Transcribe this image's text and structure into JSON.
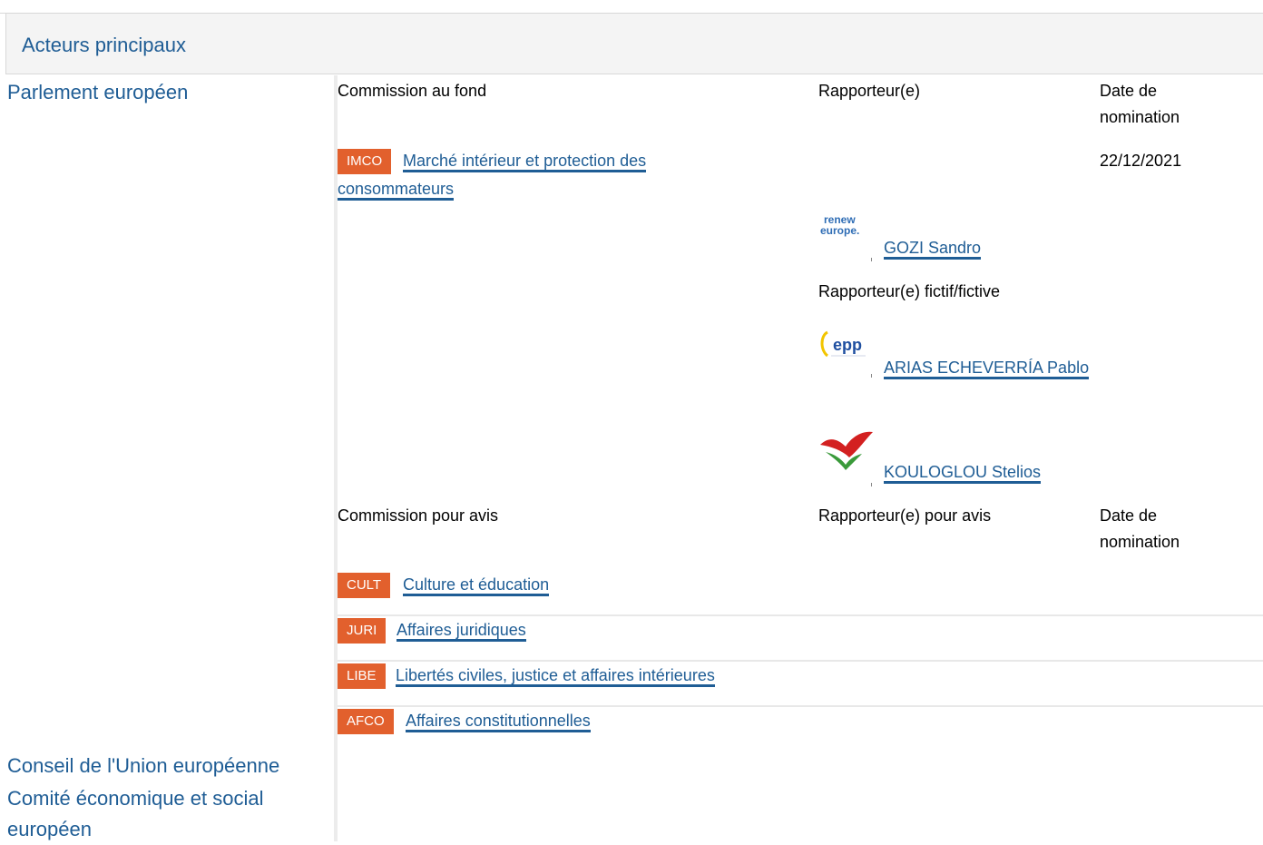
{
  "section_title": "Acteurs principaux",
  "actors": {
    "parliament": "Parlement européen",
    "council": "Conseil de l'Union européenne",
    "eesc": "Comité économique et social européen"
  },
  "responsible": {
    "committee_header": "Commission au fond",
    "rapporteur_header": "Rapporteur(e)",
    "date_header": "Date de nomination",
    "committee_code": "IMCO",
    "committee_name": "Marché intérieur et protection des consommateurs",
    "date": "22/12/2021",
    "rapporteur": {
      "name": "GOZI Sandro",
      "group_logo_text": "renew europe.",
      "group_logo_color": "#2f6db5"
    },
    "shadow_header": "Rapporteur(e) fictif/fictive",
    "shadows": [
      {
        "name": "ARIAS ECHEVERRÍA Pablo",
        "group_logo_text": "epp",
        "group_logo_color": "#1f4fa0"
      },
      {
        "name": "KOULOGLOU Stelios",
        "group_logo_text": "",
        "group_logo_color": "#d32020"
      }
    ]
  },
  "opinion": {
    "committee_header": "Commission pour avis",
    "rapporteur_header": "Rapporteur(e) pour avis",
    "date_header": "Date de nomination",
    "committees": [
      {
        "code": "CULT",
        "name": "Culture et éducation"
      },
      {
        "code": "JURI",
        "name": "Affaires juridiques"
      },
      {
        "code": "LIBE",
        "name": "Libertés civiles, justice et affaires intérieures"
      },
      {
        "code": "AFCO",
        "name": "Affaires constitutionnelles"
      }
    ]
  },
  "colors": {
    "link": "#1f5d95",
    "badge": "#e2602d",
    "header_bg": "#f4f4f4"
  }
}
